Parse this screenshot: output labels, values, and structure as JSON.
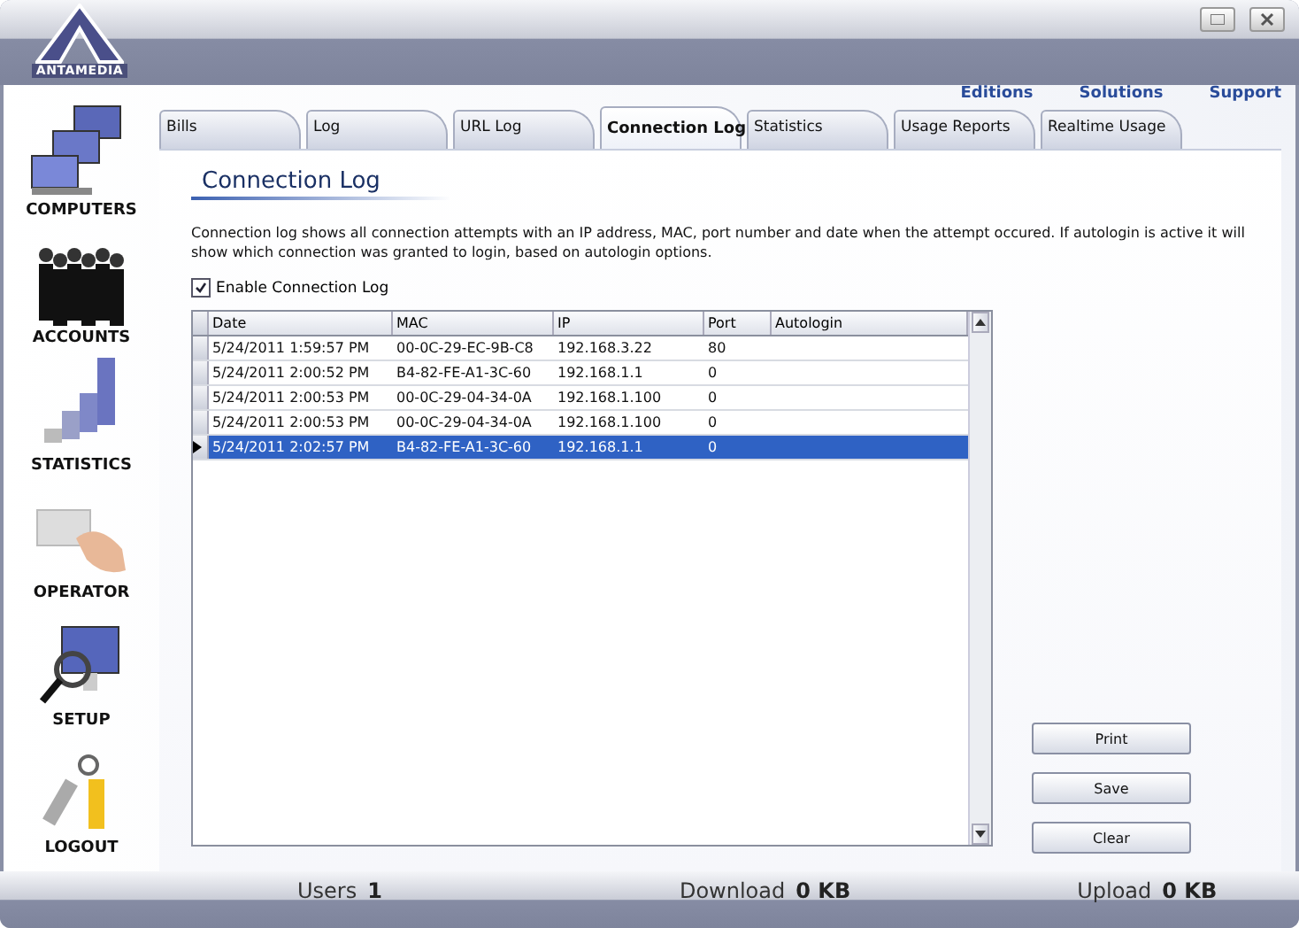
{
  "window": {
    "logo_text": "ANTAMEDIA"
  },
  "top_links": [
    "Editions",
    "Solutions",
    "Support"
  ],
  "sidebar": {
    "items": [
      {
        "label": "COMPUTERS",
        "kind": "computers"
      },
      {
        "label": "ACCOUNTS",
        "kind": "people"
      },
      {
        "label": "STATISTICS",
        "kind": "chart"
      },
      {
        "label": "OPERATOR",
        "kind": "card"
      },
      {
        "label": "SETUP",
        "kind": "monitor"
      },
      {
        "label": "LOGOUT",
        "kind": "keys"
      }
    ]
  },
  "tabs": [
    {
      "label": "Bills",
      "selected": false
    },
    {
      "label": "Log",
      "selected": false
    },
    {
      "label": "URL Log",
      "selected": false
    },
    {
      "label": "Connection Log",
      "selected": true
    },
    {
      "label": "Statistics",
      "selected": false
    },
    {
      "label": "Usage Reports",
      "selected": false
    },
    {
      "label": "Realtime Usage",
      "selected": false
    }
  ],
  "page": {
    "title": "Connection Log",
    "description": "Connection log shows all connection attempts with an IP address, MAC, port number and date when the attempt occured. If autologin is active it will show which connection was granted to login, based on autologin options.",
    "enable_checkbox": {
      "label": "Enable Connection Log",
      "checked": true
    }
  },
  "table": {
    "columns": [
      "Date",
      "MAC",
      "IP",
      "Port",
      "Autologin"
    ],
    "rows": [
      {
        "cells": [
          "5/24/2011 1:59:57 PM",
          "00-0C-29-EC-9B-C8",
          "192.168.3.22",
          "80",
          ""
        ],
        "selected": false
      },
      {
        "cells": [
          "5/24/2011 2:00:52 PM",
          "B4-82-FE-A1-3C-60",
          "192.168.1.1",
          "0",
          ""
        ],
        "selected": false
      },
      {
        "cells": [
          "5/24/2011 2:00:53 PM",
          "00-0C-29-04-34-0A",
          "192.168.1.100",
          "0",
          ""
        ],
        "selected": false
      },
      {
        "cells": [
          "5/24/2011 2:00:53 PM",
          "00-0C-29-04-34-0A",
          "192.168.1.100",
          "0",
          ""
        ],
        "selected": false
      },
      {
        "cells": [
          "5/24/2011 2:02:57 PM",
          "B4-82-FE-A1-3C-60",
          "192.168.1.1",
          "0",
          ""
        ],
        "selected": true
      }
    ]
  },
  "buttons": [
    "Print",
    "Save",
    "Clear"
  ],
  "status_bar": [
    {
      "label": "Users",
      "value": "1"
    },
    {
      "label": "Download",
      "value": "0 KB"
    },
    {
      "label": "Upload",
      "value": "0 KB"
    }
  ]
}
